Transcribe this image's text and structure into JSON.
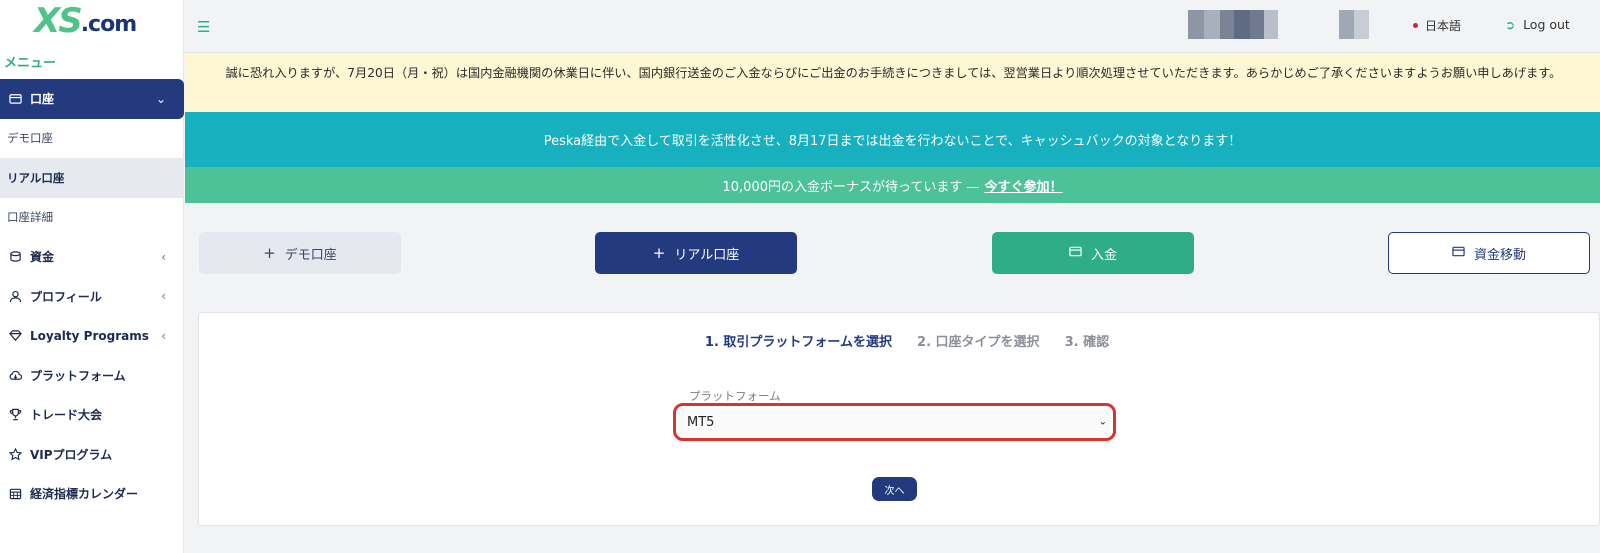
{
  "brand": {
    "logo_xs": "XS",
    "logo_com": ".com"
  },
  "sidebar": {
    "menu_title": "メニュー",
    "items": [
      {
        "label": "口座",
        "icon": "wallet-icon",
        "expanded": true
      },
      {
        "label": "資金",
        "icon": "coins-icon"
      },
      {
        "label": "プロフィール",
        "icon": "user-icon"
      },
      {
        "label": "Loyalty Programs",
        "icon": "diamond-icon"
      },
      {
        "label": "プラットフォーム",
        "icon": "cloud-download-icon"
      },
      {
        "label": "トレード大会",
        "icon": "trophy-icon"
      },
      {
        "label": "VIPプログラム",
        "icon": "star-icon"
      },
      {
        "label": "経済指標カレンダー",
        "icon": "calendar-icon"
      }
    ],
    "subitems": [
      {
        "label": "デモ口座"
      },
      {
        "label": "リアル口座",
        "selected": true
      },
      {
        "label": "口座詳細"
      }
    ]
  },
  "header": {
    "language": "日本語",
    "logout": "Log out"
  },
  "banners": {
    "notice": "誠に恐れ入りますが、7月20日（月・祝）は国内金融機関の休業日に伴い、国内銀行送金のご入金ならびにご出金のお手続きにつきましては、翌営業日より順次処理させていただきます。あらかじめご了承くださいますようお願い申しあげます。",
    "peska": "Peska経由で入金して取引を活性化させ、8月17日までは出金を行わないことで、キャッシュバックの対象となります！",
    "bonus_text": "10,000円の入金ボーナスが待っています —",
    "bonus_link": "今すぐ参加！"
  },
  "actions": {
    "demo": "デモ口座",
    "real": "リアル口座",
    "deposit": "入金",
    "transfer": "資金移動"
  },
  "wizard": {
    "steps": [
      "1.  取引プラットフォームを選択",
      "2.  口座タイプを選択",
      "3.  確認"
    ],
    "current_step": 1,
    "platform_label": "プラットフォーム",
    "platform_value": "MT5",
    "next": "次へ"
  },
  "colors": {
    "primary": "#233a7e",
    "accent": "#2fae86",
    "teal": "#16b0bf",
    "highlight": "#d9332f"
  }
}
